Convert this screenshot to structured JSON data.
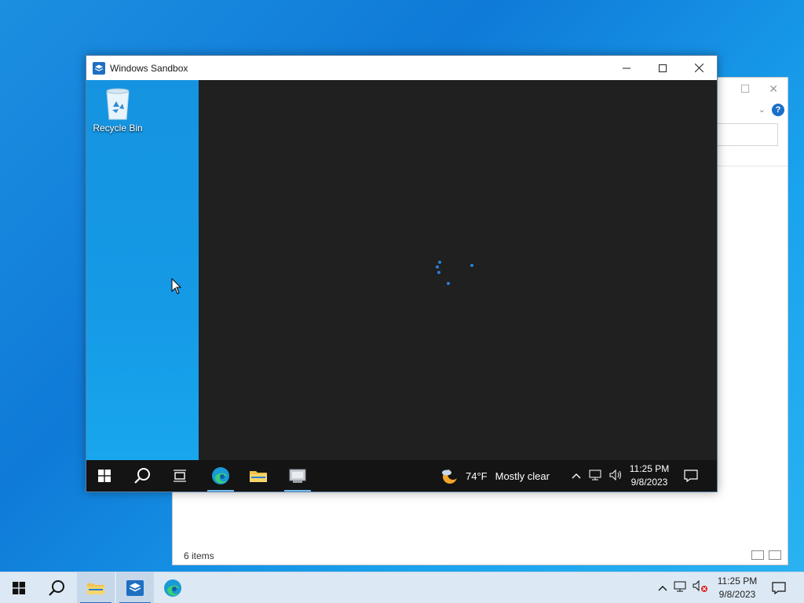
{
  "sandbox_window": {
    "title": "Windows Sandbox",
    "icon": "windows-sandbox-icon",
    "controls": [
      "minimize",
      "maximize",
      "close"
    ]
  },
  "sandbox_desktop": {
    "recycle_bin_label": "Recycle Bin"
  },
  "sandbox_taskbar": {
    "pinned": [
      "start",
      "search",
      "task-view",
      "edge",
      "file-explorer",
      "windows-sandbox"
    ],
    "weather": {
      "temp": "74°F",
      "condition": "Mostly clear"
    },
    "clock": {
      "time": "11:25 PM",
      "date": "9/8/2023"
    }
  },
  "host_explorer": {
    "status": "6 items"
  },
  "host_taskbar": {
    "pinned": [
      "start",
      "search",
      "file-explorer",
      "windows-sandbox",
      "edge"
    ],
    "clock": {
      "time": "11:25 PM",
      "date": "9/8/2023"
    }
  },
  "colors": {
    "desktop_blue": "#0f7ad8",
    "sandbox_inner_bg": "#202020",
    "sandbox_taskbar": "#141414",
    "host_taskbar": "#dce8f4",
    "accent": "#1e6fc2"
  }
}
